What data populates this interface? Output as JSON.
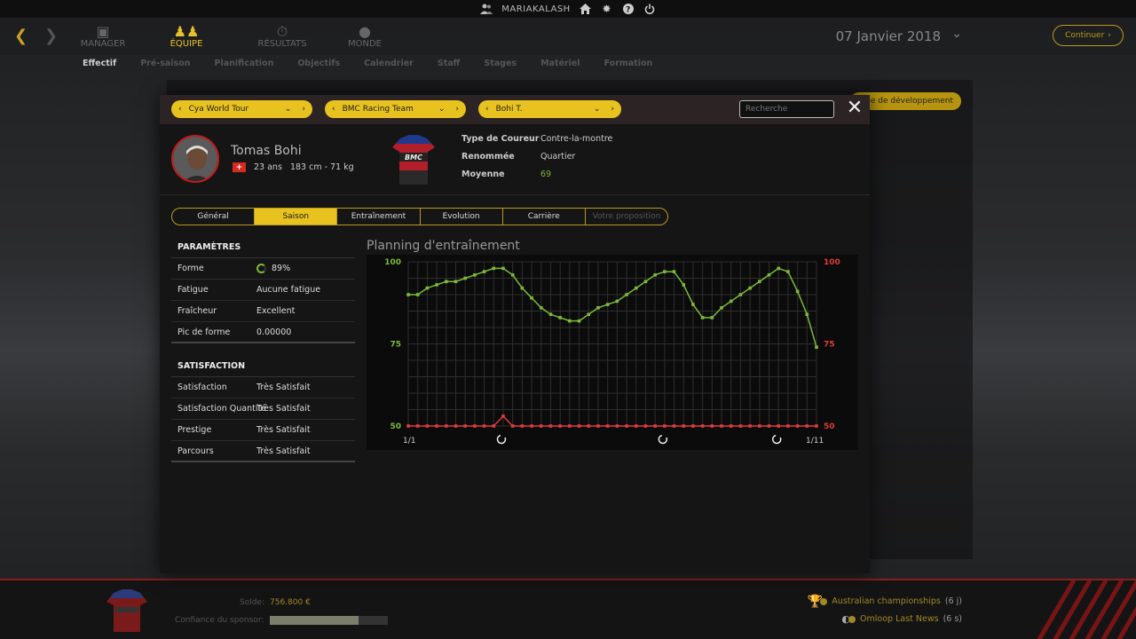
{
  "topbar": {
    "username": "MARIAKALASH"
  },
  "nav": {
    "items": [
      {
        "label": "MANAGER",
        "icon": "briefcase-icon"
      },
      {
        "label": "ÉQUIPE",
        "icon": "team-icon"
      },
      {
        "label": "RÉSULTATS",
        "icon": "stopwatch-icon"
      },
      {
        "label": "MONDE",
        "icon": "globe-icon"
      }
    ],
    "date": "07 Janvier 2018",
    "continue_label": "Continuer"
  },
  "subnav": [
    "Effectif",
    "Pré-saison",
    "Planification",
    "Objectifs",
    "Calendrier",
    "Staff",
    "Stages",
    "Matériel",
    "Formation"
  ],
  "background": {
    "dev_team_tab": "uipe de développement"
  },
  "bottom": {
    "solde_label": "Solde:",
    "solde_value": "756.800 €",
    "sponsor_label": "Confiance du sponsor:",
    "sponsor_confidence": 0.75,
    "news": [
      {
        "label": "Australian championships",
        "count": "(6 j)"
      },
      {
        "label": "Omloop Last News",
        "count": "(6 s)"
      }
    ]
  },
  "modal": {
    "selectors": {
      "league": "Cya World Tour",
      "team": "BMC Racing Team",
      "rider": "Bohi T."
    },
    "search_placeholder": "Recherche",
    "player": {
      "name": "Tomas Bohi",
      "info": "23 ans   183 cm - 71 kg",
      "attrs": [
        {
          "label": "Type de Coureur",
          "value": "Contre-la-montre"
        },
        {
          "label": "Renommée",
          "value": "Quartier"
        },
        {
          "label": "Moyenne",
          "value": "69"
        }
      ]
    },
    "tabs": [
      "Général",
      "Saison",
      "Entraînement",
      "Evolution",
      "Carrière",
      "Votre proposition"
    ],
    "active_tab": "Saison",
    "params": {
      "title": "PARAMÈTRES",
      "rows": [
        {
          "k": "Forme",
          "v": "89%"
        },
        {
          "k": "Fatigue",
          "v": "Aucune fatigue"
        },
        {
          "k": "Fraîcheur",
          "v": "Excellent"
        },
        {
          "k": "Pic de forme",
          "v": "0.00000"
        }
      ]
    },
    "satisfaction": {
      "title": "SATISFACTION",
      "rows": [
        {
          "k": "Satisfaction",
          "v": "Très Satisfait"
        },
        {
          "k": "Satisfaction Quantité",
          "v": "Très Satisfait"
        },
        {
          "k": "Prestige",
          "v": "Très Satisfait"
        },
        {
          "k": "Parcours",
          "v": "Très Satisfait"
        }
      ]
    },
    "chart_title": "Planning d'entraînement"
  },
  "chart_data": {
    "type": "line",
    "x_labels": [
      "1/1",
      "1/11"
    ],
    "y_left": {
      "ticks": [
        "100",
        "75",
        "50"
      ],
      "range": [
        50,
        100
      ],
      "color": "#7cba3a"
    },
    "y_right": {
      "ticks": [
        "100",
        "75",
        "50"
      ],
      "range": [
        50,
        100
      ],
      "color": "#e03c3c"
    },
    "series": [
      {
        "color": "#7cba3a",
        "values": [
          90,
          90,
          92,
          93,
          94,
          94,
          95,
          96,
          97,
          98,
          98,
          96,
          92,
          89,
          86,
          84,
          83,
          82,
          82,
          84,
          86,
          87,
          88,
          90,
          92,
          94,
          96,
          97,
          97,
          93,
          87,
          83,
          83,
          86,
          88,
          90,
          92,
          94,
          96,
          98,
          97,
          91,
          84,
          74
        ]
      },
      {
        "color": "#e03c3c",
        "values": [
          50,
          50,
          50,
          50,
          50,
          50,
          50,
          50,
          50,
          50,
          53,
          50,
          50,
          50,
          50,
          50,
          50,
          50,
          50,
          50,
          50,
          50,
          50,
          50,
          50,
          50,
          50,
          50,
          50,
          50,
          50,
          50,
          50,
          50,
          50,
          50,
          50,
          50,
          50,
          50,
          50,
          50,
          50,
          50
        ]
      }
    ],
    "markers": [
      10,
      27,
      39
    ],
    "grid": true
  }
}
